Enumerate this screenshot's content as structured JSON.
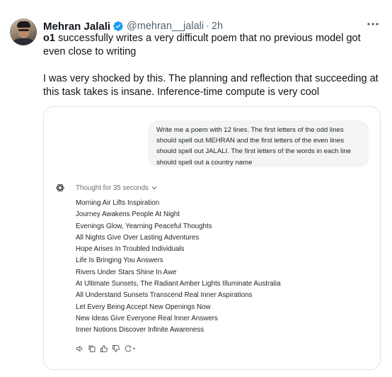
{
  "author": {
    "display_name": "Mehran Jalali",
    "handle": "@mehran__jalali",
    "separator": "·",
    "time": "2h"
  },
  "tweet": {
    "line1_bold": "o1",
    "line1_rest": " successfully writes a very difficult poem that no previous model got even close to writing",
    "para2": "I was very shocked by this.  The planning and reflection that succeeding at this task takes is insane.  Inference-time compute is very cool"
  },
  "chat": {
    "prompt": "Write me a poem with 12 lines.  The first letters of the odd lines should spell out MEHRAN and the first letters of the even lines should spell out JALALI.  The first letters of the words in each line should spell out a country name",
    "thought_label": "Thought for 35 seconds",
    "poem_lines": [
      "Morning Air Lifts Inspiration",
      "Journey Awakens People At Night",
      "Evenings Glow, Yearning Peaceful Thoughts",
      "All Nights Give Over Lasting Adventures",
      "Hope Arises In Troubled Individuals",
      "Life Is Bringing You Answers",
      "Rivers Under Stars Shine In Awe",
      "At Ultimate Sunsets, The Radiant Amber Lights Illuminate Australia",
      "All Understand Sunsets Transcend Real Inner Aspirations",
      "Let Every Being Accept New Openings Now",
      "New Ideas Give Everyone Real Inner Answers",
      "Inner Notions Discover Infinite Awareness"
    ]
  },
  "icons": {
    "verified": "verified-badge-icon",
    "more": "more-options-icon",
    "assistant": "chatgpt-logo-icon",
    "actions": [
      "read-aloud-icon",
      "copy-icon",
      "thumbs-up-icon",
      "thumbs-down-icon",
      "regenerate-icon"
    ]
  },
  "colors": {
    "verified": "#1d9bf0",
    "handle": "#536471",
    "bubble": "#f3f4f4",
    "card_border": "#dfe3e7"
  }
}
